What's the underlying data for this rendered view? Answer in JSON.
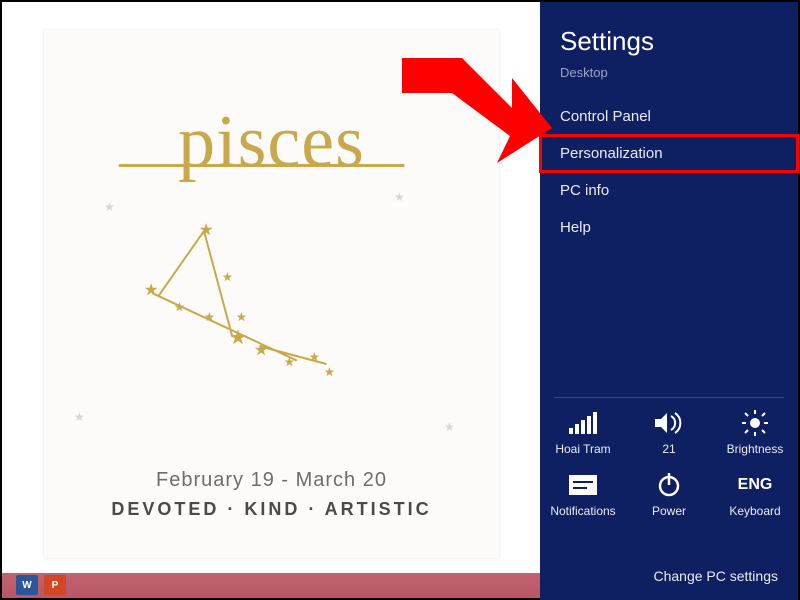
{
  "wallpaper": {
    "title": "pisces",
    "date_range": "February 19 - March 20",
    "traits": "DEVOTED · KIND · ARTISTIC"
  },
  "taskbar": {
    "apps": [
      {
        "name": "word",
        "label": "W"
      },
      {
        "name": "powerpoint",
        "label": "P"
      }
    ]
  },
  "settings": {
    "title": "Settings",
    "subtitle": "Desktop",
    "items": [
      {
        "label": "Control Panel",
        "highlight": false
      },
      {
        "label": "Personalization",
        "highlight": true
      },
      {
        "label": "PC info",
        "highlight": false
      },
      {
        "label": "Help",
        "highlight": false
      }
    ],
    "tiles": {
      "network": {
        "label": "Hoai Tram"
      },
      "volume": {
        "label": "21"
      },
      "brightness": {
        "label": "Brightness"
      },
      "notifications": {
        "label": "Notifications"
      },
      "power": {
        "label": "Power"
      },
      "keyboard": {
        "big": "ENG",
        "label": "Keyboard"
      }
    },
    "change_link": "Change PC settings"
  }
}
